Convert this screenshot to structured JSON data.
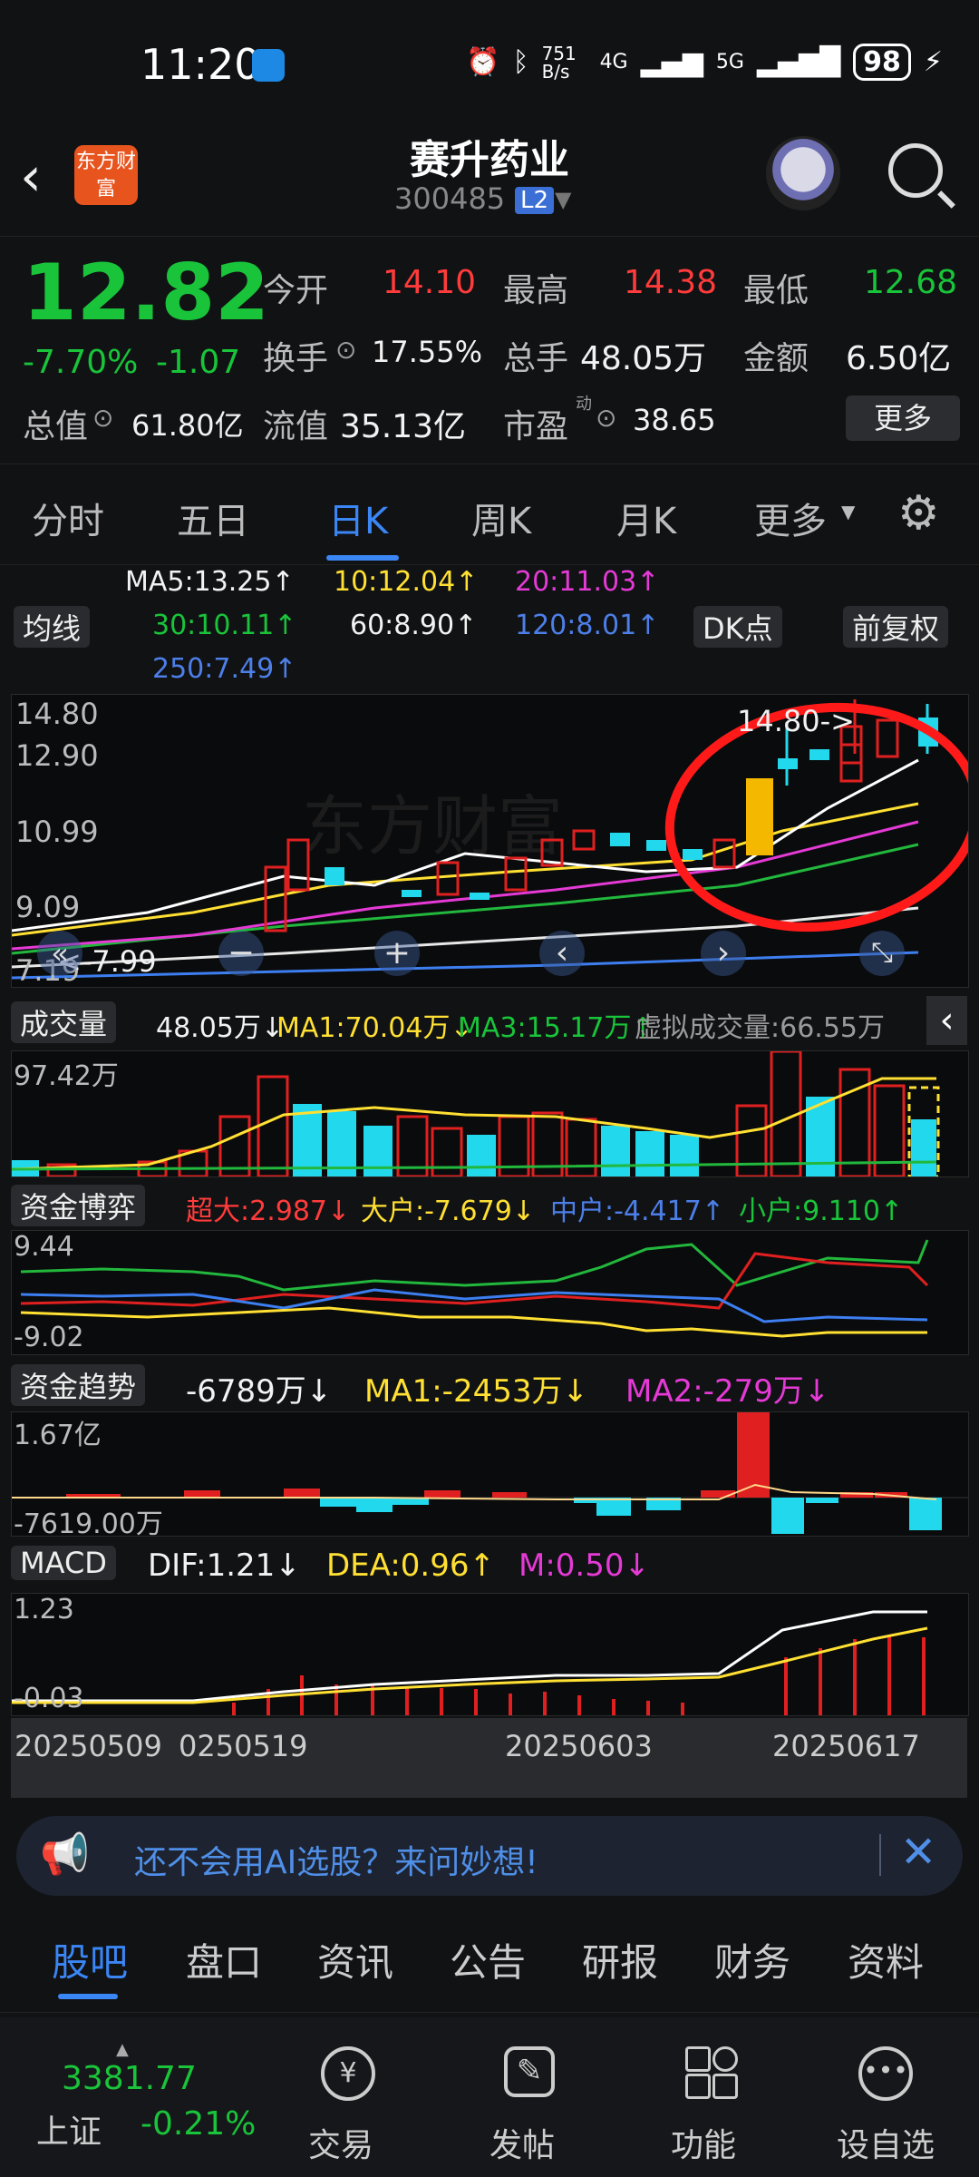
{
  "status": {
    "time": "11:20",
    "net_speed": "751 B/s",
    "signal1": "4G",
    "signal2": "5G",
    "battery": "98"
  },
  "header": {
    "stock_name": "赛升药业",
    "stock_code": "300485",
    "level_badge": "L2",
    "logo_text": "东方财富"
  },
  "quote": {
    "price": "12.82",
    "change_pct": "-7.70%",
    "change": "-1.07",
    "open_label": "今开",
    "open": "14.10",
    "high_label": "最高",
    "high": "14.38",
    "low_label": "最低",
    "low": "12.68",
    "turnover_label": "换手",
    "turnover": "17.55%",
    "volume_label": "总手",
    "volume": "48.05万",
    "amount_label": "金额",
    "amount": "6.50亿",
    "mktcap_label": "总值",
    "mktcap": "61.80亿",
    "float_label": "流值",
    "float": "35.13亿",
    "pe_label": "市盈",
    "pe_sup": "动",
    "pe": "38.65",
    "more": "更多"
  },
  "tabs": [
    "分时",
    "五日",
    "日K",
    "周K",
    "月K",
    "更多"
  ],
  "ma_legend": {
    "toggle": "均线",
    "ma5": "MA5:13.25↑",
    "ma10": "10:12.04↑",
    "ma20": "20:11.03↑",
    "ma30": "30:10.11↑",
    "ma60": "60:8.90↑",
    "ma120": "120:8.01↑",
    "ma250": "250:7.49↑",
    "dk": "DK点",
    "adjust": "前复权"
  },
  "kline": {
    "y_labels": [
      "14.80",
      "12.90",
      "10.99",
      "9.09",
      "7.19"
    ],
    "annot_high": "14.80->",
    "annot_low": "<-7.99",
    "watermark": "东方财富"
  },
  "volume_panel": {
    "label": "成交量",
    "vol": "48.05万↓",
    "ma1": "MA1:70.04万↓",
    "ma3": "MA3:15.17万↑",
    "virtual": "虚拟成交量:66.55万",
    "y_top": "97.42万"
  },
  "funds_game": {
    "label": "资金博弈",
    "super": "超大:2.987↓",
    "big": "大户:-7.679↓",
    "mid": "中户:-4.417↑",
    "small": "小户:9.110↑",
    "y_top": "9.44",
    "y_bot": "-9.02"
  },
  "funds_trend": {
    "label": "资金趋势",
    "val": "-6789万↓",
    "ma1": "MA1:-2453万↓",
    "ma2": "MA2:-279万↓",
    "y_top": "1.67亿",
    "y_bot": "-7619.00万"
  },
  "macd": {
    "label": "MACD",
    "dif": "DIF:1.21↓",
    "dea": "DEA:0.96↑",
    "m": "M:0.50↓",
    "y_top": "1.23",
    "y_bot": "-0.03"
  },
  "dates": [
    "20250509",
    "0250519",
    "20250603",
    "20250617"
  ],
  "banner": {
    "text": "还不会用AI选股？来问妙想!"
  },
  "bottom_tabs": [
    "股吧",
    "盘口",
    "资讯",
    "公告",
    "研报",
    "财务",
    "资料"
  ],
  "bottom_nav": {
    "index_value": "3381.77",
    "index_name": "上证",
    "index_change": "-0.21%",
    "trade": "交易",
    "post": "发帖",
    "functions": "功能",
    "watchlist": "设自选"
  }
}
